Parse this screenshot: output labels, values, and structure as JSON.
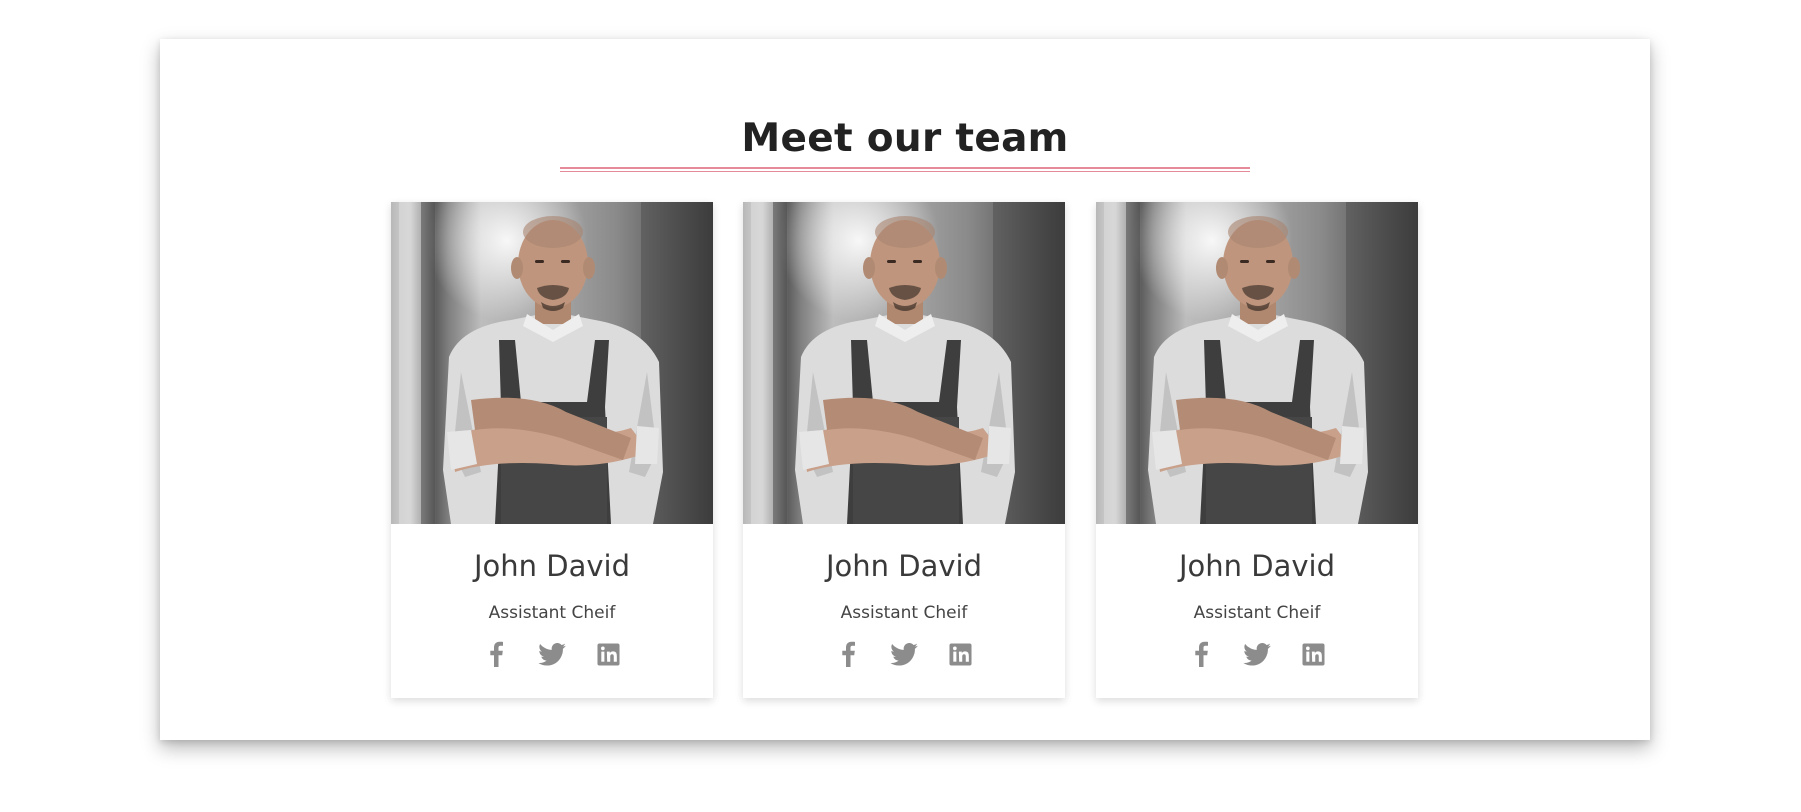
{
  "section": {
    "title": "Meet our team",
    "accent_color": "#e58a98"
  },
  "team": [
    {
      "name": "John David",
      "role": "Assistant Cheif",
      "photo": "chef-portrait",
      "socials": [
        "facebook-icon",
        "twitter-icon",
        "linkedin-icon"
      ]
    },
    {
      "name": "John David",
      "role": "Assistant Cheif",
      "photo": "chef-portrait",
      "socials": [
        "facebook-icon",
        "twitter-icon",
        "linkedin-icon"
      ]
    },
    {
      "name": "John David",
      "role": "Assistant Cheif",
      "photo": "chef-portrait",
      "socials": [
        "facebook-icon",
        "twitter-icon",
        "linkedin-icon"
      ]
    }
  ],
  "colors": {
    "icon": "#8c8c8c",
    "text": "#3a3a3a"
  }
}
